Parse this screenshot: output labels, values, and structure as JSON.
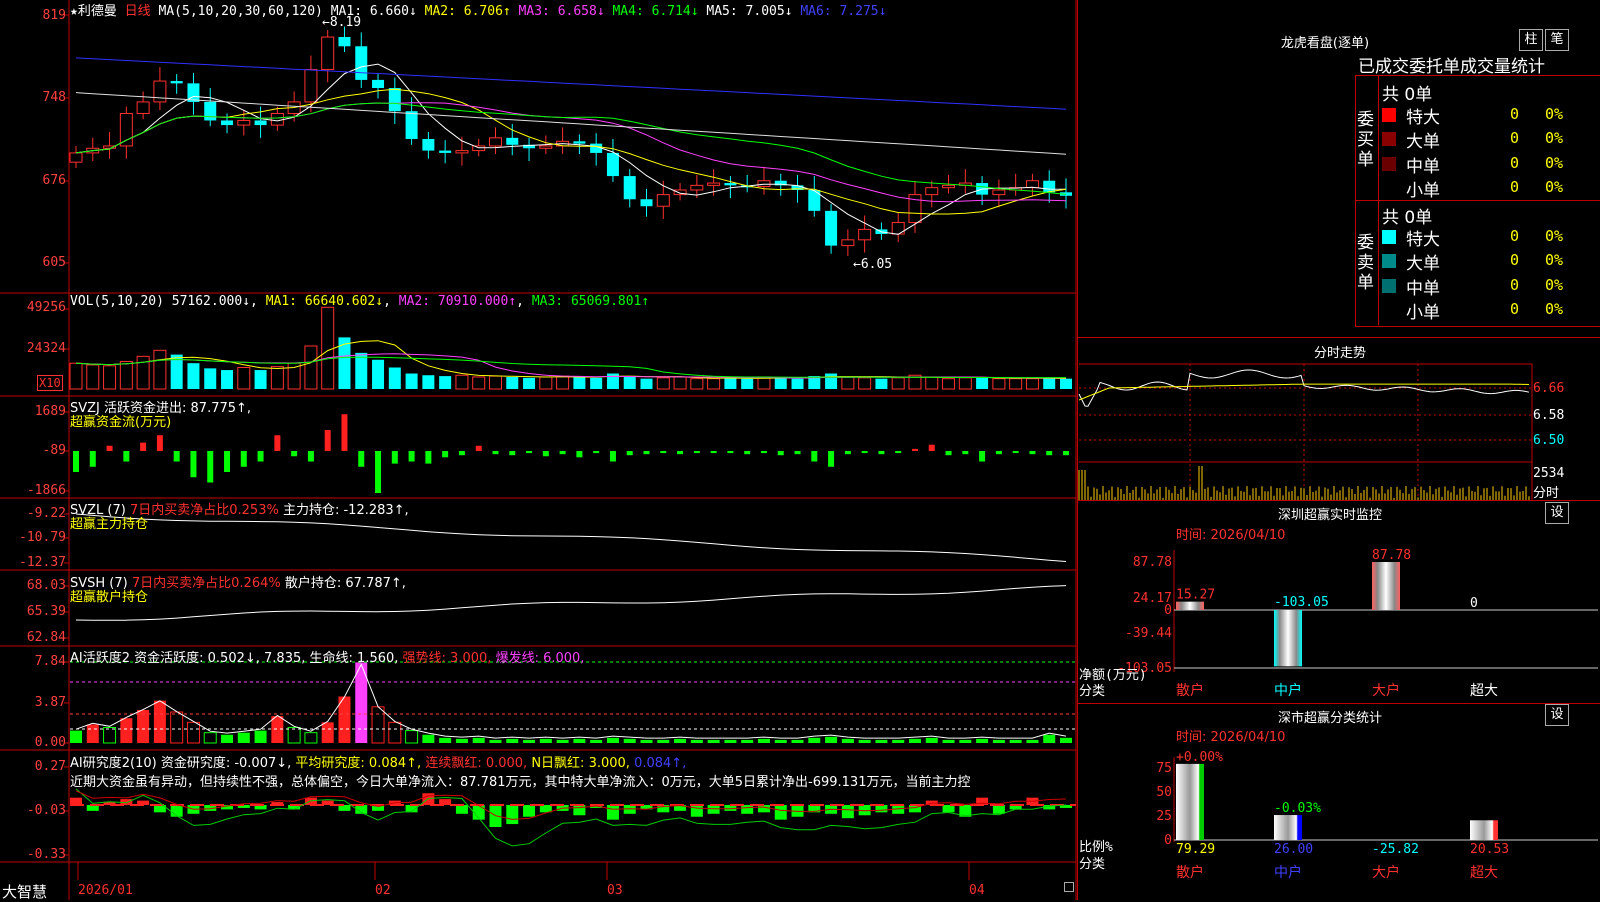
{
  "main": {
    "star": "★",
    "stock_name": "利德曼",
    "period": "日线",
    "ma_params": "MA(5,10,20,30,60,120)",
    "ma": [
      {
        "label": "MA1:",
        "value": "6.660↓",
        "color": "#ffffff"
      },
      {
        "label": "MA2:",
        "value": "6.706↑",
        "color": "#ffff00"
      },
      {
        "label": "MA3:",
        "value": "6.658↓",
        "color": "#ff40ff"
      },
      {
        "label": "MA4:",
        "value": "6.714↓",
        "color": "#00ff00"
      },
      {
        "label": "MA5:",
        "value": "7.005↓",
        "color": "#ffffff"
      },
      {
        "label": "MA6:",
        "value": "7.275↓",
        "color": "#4040ff"
      }
    ],
    "y_ticks": [
      "819",
      "748",
      "676",
      "605"
    ],
    "high_label": "8.19",
    "low_label": "6.05"
  },
  "vol": {
    "title": "VOL(5,10,20)",
    "value": "57162.000↓",
    "ma1": "MA1: 66640.602↓",
    "ma2": "MA2: 70910.000↑",
    "ma3": "MA3: 65069.801↑",
    "y_ticks": [
      "49256",
      "24324"
    ],
    "unit": "X10"
  },
  "svzj": {
    "title": "SVZJ 活跃资金进出: 87.775↑,",
    "sub": "超赢资金流(万元)",
    "y_ticks": [
      "1689",
      "-89",
      "-1866"
    ]
  },
  "svzl": {
    "title1": "SVZL (7)",
    "title2": "7日内买卖净占比0.253%",
    "title3": "主力持仓: -12.283↑,",
    "sub": "超赢主力持仓",
    "y_ticks": [
      "-9.22",
      "-10.79",
      "-12.37"
    ]
  },
  "svsh": {
    "title1": "SVSH (7)",
    "title2": "7日内买卖净占比0.264%",
    "title3": "散户持仓: 67.787↑,",
    "sub": "超赢散户持仓",
    "y_ticks": [
      "68.03",
      "65.39",
      "62.84"
    ]
  },
  "ai2": {
    "t1": "AI活跃度2 资金活跃度: 0.502↓,",
    "t2": "7.835,",
    "t3": "生命线: 1.560,",
    "t4": "强势线: 3.000,",
    "t5": "爆发线: 6.000,",
    "y_ticks": [
      "7.84",
      "3.87",
      "0.00"
    ]
  },
  "ai_res": {
    "t1": "AI研究度2(10) 资金研究度: -0.007↓,",
    "t2": "平均研究度: 0.084↑,",
    "t3": "连续飘红: 0.000,",
    "t4": "N日飘红: 3.000,",
    "t5": "0.084↑,",
    "comment": "近期大资金虽有异动，但持续性不强，总体偏空，今日大单净流入：87.781万元，其中特大单净流入：0万元，大单5日累计净出-699.131万元，当前主力控",
    "y_ticks": [
      "0.27",
      "-0.03",
      "-0.33"
    ]
  },
  "xaxis": {
    "brand": "大智慧",
    "labels": [
      "2026/01",
      "02",
      "03",
      "04"
    ]
  },
  "dragon": {
    "title": "龙虎看盘(逐单)",
    "btn1": "柱",
    "btn2": "笔",
    "header": "已成交委托单成交量统计",
    "buy_label": "委买单",
    "sell_label": "委卖单",
    "buy_total": "共 0单",
    "sell_total": "共 0单",
    "buy_rows": [
      {
        "name": "特大",
        "count": "0",
        "pct": "0%",
        "color": "#ff0000"
      },
      {
        "name": "大单",
        "count": "0",
        "pct": "0%",
        "color": "#8b0000"
      },
      {
        "name": "中单",
        "count": "0",
        "pct": "0%",
        "color": "#6b0000"
      },
      {
        "name": "小单",
        "count": "0",
        "pct": "0%",
        "color": "#000000"
      }
    ],
    "sell_rows": [
      {
        "name": "特大",
        "count": "0",
        "pct": "0%",
        "color": "#00ffff"
      },
      {
        "name": "大单",
        "count": "0",
        "pct": "0%",
        "color": "#008b8b"
      },
      {
        "name": "中单",
        "count": "0",
        "pct": "0%",
        "color": "#007070"
      },
      {
        "name": "小单",
        "count": "0",
        "pct": "0%",
        "color": "#000000"
      }
    ]
  },
  "intraday": {
    "title": "分时走势",
    "y_ticks": [
      "6.66",
      "6.58",
      "6.50"
    ],
    "vol_tick": "2534",
    "vol_unit": "分时"
  },
  "sz_monitor": {
    "title": "深圳超赢实时监控",
    "set_btn": "设",
    "time": "时间: 2026/04/10",
    "y_ticks": [
      "87.78",
      "24.17",
      "0",
      "-39.44",
      "-103.05"
    ],
    "ylabel": "净额(万元)",
    "xlabel": "分类",
    "categories": [
      "散户",
      "中户",
      "大户",
      "超大"
    ],
    "values": [
      15.27,
      -103.05,
      87.78,
      0
    ],
    "value_labels": [
      "15.27",
      "-103.05",
      "87.78",
      "0"
    ]
  },
  "sz_class": {
    "title": "深市超赢分类统计",
    "set_btn": "设",
    "time": "时间: 2026/04/10",
    "y_ticks": [
      "75",
      "50",
      "25",
      "0"
    ],
    "ylabel": "比例%",
    "xlabel": "分类",
    "categories": [
      "散户",
      "中户",
      "大户",
      "超大"
    ],
    "top_labels": [
      "+0.00%",
      "-0.03%",
      "",
      ""
    ],
    "values": [
      79.29,
      26.0,
      -25.82,
      20.53
    ],
    "value_labels": [
      "79.29",
      "26.00",
      "-25.82",
      "20.53"
    ]
  }
}
